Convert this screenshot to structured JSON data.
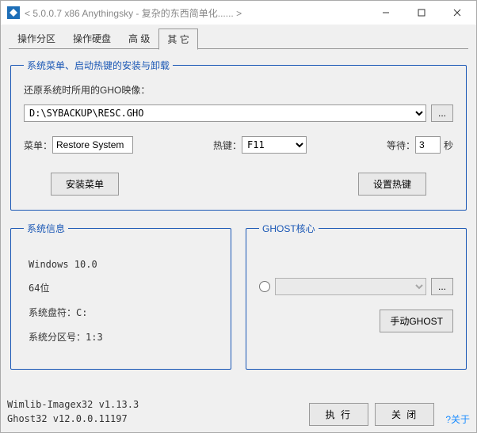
{
  "titlebar": {
    "text": "< 5.0.0.7 x86 Anythingsky - 复杂的东西简单化...... >"
  },
  "tabs": {
    "t1": "操作分区",
    "t2": "操作硬盘",
    "t3": "高  级",
    "t4": "其  它"
  },
  "group1": {
    "legend": "系统菜单、启动热键的安装与卸载",
    "gho_label": "还原系统时所用的GHO映像：",
    "gho_value": "D:\\SYBACKUP\\RESC.GHO",
    "dots": "...",
    "menu_label": "菜单：",
    "menu_value": "Restore System",
    "hotkey_label": "热键：",
    "hotkey_value": "F11",
    "wait_label": "等待：",
    "wait_value": "3",
    "wait_unit": "秒",
    "install_btn": "安装菜单",
    "hotkey_btn": "设置热键"
  },
  "sysinfo": {
    "legend": "系统信息",
    "os": "Windows 10.0",
    "bits": "64位",
    "drive": "系统盘符：C:",
    "part": "系统分区号：1:3"
  },
  "ghost": {
    "legend": "GHOST核心",
    "dots": "...",
    "manual_btn": "手动GHOST"
  },
  "footer": {
    "ver1": "Wimlib-Imagex32 v1.13.3",
    "ver2": "Ghost32 v12.0.0.11197",
    "exec": "执 行",
    "close": "关 闭",
    "about": "?关于"
  }
}
